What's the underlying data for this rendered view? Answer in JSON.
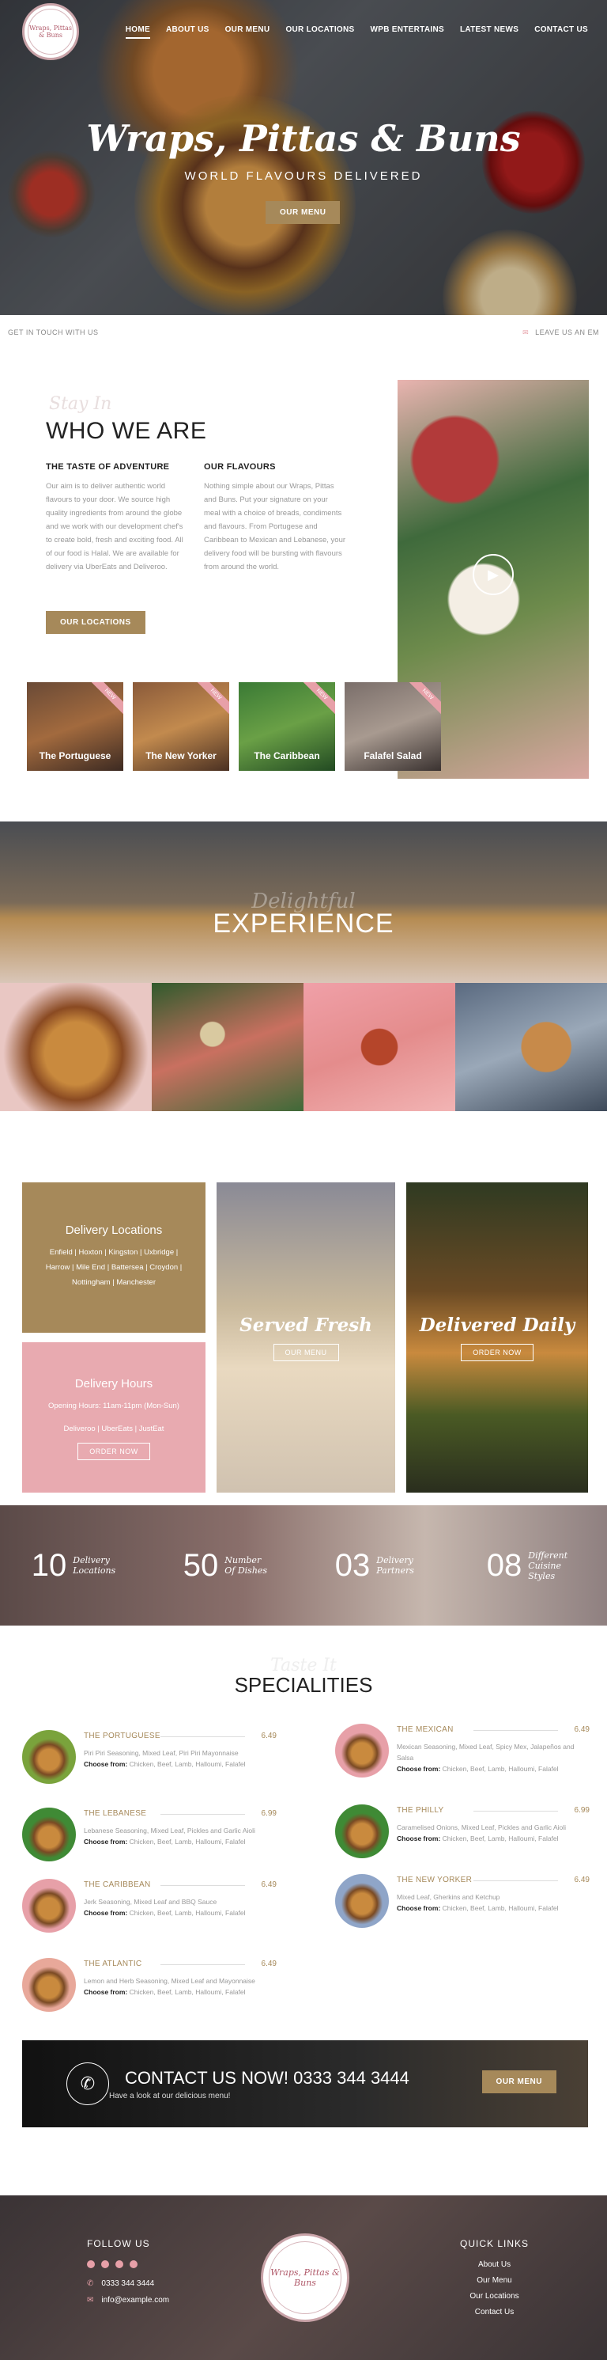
{
  "logo": {
    "text": "Wraps, Pittas & Buns"
  },
  "nav": [
    {
      "label": "HOME",
      "active": true
    },
    {
      "label": "ABOUT US"
    },
    {
      "label": "OUR MENU"
    },
    {
      "label": "OUR LOCATIONS"
    },
    {
      "label": "WPB ENTERTAINS"
    },
    {
      "label": "LATEST NEWS"
    },
    {
      "label": "CONTACT US"
    }
  ],
  "hero": {
    "title": "Wraps, Pittas & Buns",
    "tagline": "WORLD FLAVOURS DELIVERED",
    "button": "OUR MENU"
  },
  "ticker": {
    "left": "GET IN TOUCH WITH US",
    "right": "LEAVE US AN EM"
  },
  "who": {
    "script": "Stay In",
    "title": "WHO WE ARE",
    "col1_title": "THE TASTE OF ADVENTURE",
    "col1_text": "Our aim is to deliver authentic world flavours to your door. We source high quality ingredients from around the globe and we work with our development chef's to create bold, fresh and exciting food. All of our food is Halal. We are available for delivery via UberEats and Deliveroo.",
    "col2_title": "OUR FLAVOURS",
    "col2_text": "Nothing simple about our Wraps, Pittas and Buns. Put your signature on your meal with a choice of breads, condiments and flavours. From Portugese and Caribbean to Mexican and Lebanese, your delivery food will be bursting with flavours from around the world.",
    "button": "OUR LOCATIONS",
    "cards": [
      {
        "label": "The Portuguese",
        "ribbon": "NEW"
      },
      {
        "label": "The New Yorker",
        "ribbon": "NEW"
      },
      {
        "label": "The Caribbean",
        "ribbon": "NEW"
      },
      {
        "label": "Falafel Salad",
        "ribbon": "NEW"
      }
    ]
  },
  "experience": {
    "script": "Delightful",
    "title": "EXPERIENCE"
  },
  "delivery": {
    "loc_title": "Delivery Locations",
    "loc_text": "Enfield | Hoxton | Kingston | Uxbridge | Harrow | Mile End | Battersea | Croydon | Nottingham | Manchester",
    "hours_title": "Delivery Hours",
    "hours_text": "Opening Hours: 11am-11pm (Mon-Sun)",
    "hours_partners": "Deliveroo | UberEats | JustEat",
    "hours_button": "ORDER NOW",
    "served_title": "Served Fresh",
    "served_button": "OUR MENU",
    "daily_title": "Delivered Daily",
    "daily_button": "ORDER NOW"
  },
  "stats": [
    {
      "num": "10",
      "label": "Delivery Locations"
    },
    {
      "num": "50",
      "label": "Number Of Dishes"
    },
    {
      "num": "03",
      "label": "Delivery Partners"
    },
    {
      "num": "08",
      "label": "Different Cuisine Styles"
    }
  ],
  "specialities": {
    "script": "Taste It",
    "title": "SPECIALITIES",
    "choose_label": "Choose from:",
    "choose_options": "Chicken, Beef, Lamb, Halloumi, Falafel",
    "items": [
      {
        "name": "THE PORTUGUESE",
        "price": "6.49",
        "desc": "Piri Piri Seasoning, Mixed Leaf, Piri Piri Mayonnaise",
        "color": "#7aa33c"
      },
      {
        "name": "THE LEBANESE",
        "price": "6.99",
        "desc": "Lebanese Seasoning, Mixed Leaf, Pickles and Garlic Aioli",
        "color": "#3f8a35"
      },
      {
        "name": "THE CARIBBEAN",
        "price": "6.49",
        "desc": "Jerk Seasoning, Mixed Leaf and BBQ Sauce",
        "color": "#e7a0a8"
      },
      {
        "name": "THE ATLANTIC",
        "price": "6.49",
        "desc": "Lemon and Herb Seasoning, Mixed Leaf and Mayonnaise",
        "color": "#e8a89a"
      },
      {
        "name": "THE MEXICAN",
        "price": "6.49",
        "desc": "Mexican Seasoning, Mixed Leaf, Spicy Mex, Jalapeños and Salsa",
        "color": "#e7a0a8"
      },
      {
        "name": "THE PHILLY",
        "price": "6.99",
        "desc": "Caramelised Onions, Mixed Leaf, Pickles and Garlic Aioli",
        "color": "#3f8a35"
      },
      {
        "name": "THE NEW YORKER",
        "price": "6.49",
        "desc": "Mixed Leaf, Gherkins and Ketchup",
        "color": "#8fa5c8"
      }
    ]
  },
  "contact": {
    "title": "CONTACT US NOW! 0333 344 3444",
    "subtitle": "Have a look at our delicious menu!",
    "button": "OUR MENU"
  },
  "footer": {
    "follow_title": "FOLLOW US",
    "phone": "0333 344 3444",
    "email": "info@example.com",
    "logo_text": "Wraps, Pittas & Buns",
    "links_title": "QUICK LINKS",
    "links": [
      "About Us",
      "Our Menu",
      "Our Locations",
      "Contact Us"
    ]
  },
  "colors": {
    "gold": "#a6895a",
    "pink": "#e7a0a8",
    "dark": "#222222"
  }
}
